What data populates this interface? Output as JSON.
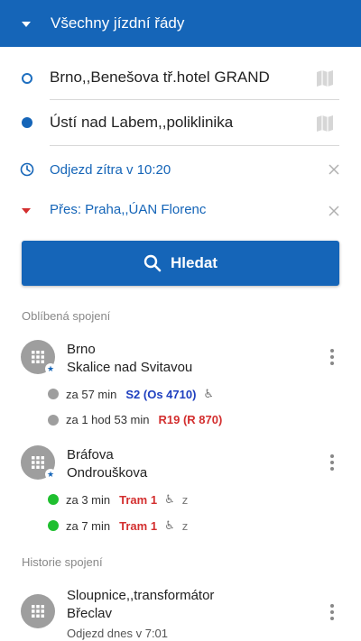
{
  "header": {
    "title": "Všechny jízdní řády"
  },
  "route": {
    "from": "Brno,,Benešova tř.hotel GRAND",
    "to": "Ústí nad Labem,,poliklinika"
  },
  "options": {
    "departure": "Odjezd zítra v 10:20",
    "via": "Přes: Praha,,ÚAN Florenc"
  },
  "search_button": {
    "label": "Hledat"
  },
  "favorites": {
    "header": "Oblíbená spojení",
    "items": [
      {
        "from": "Brno",
        "to": "Skalice nad Svitavou",
        "departures": [
          {
            "time": "za 57 min",
            "line": "S2 (Os 4710)",
            "status_color": "#9e9e9e",
            "line_color": "#1e3fbf",
            "accessible": "♿",
            "z": ""
          },
          {
            "time": "za 1 hod 53 min",
            "line": "R19 (R 870)",
            "status_color": "#9e9e9e",
            "line_color": "#d32f2f",
            "accessible": "",
            "z": ""
          }
        ]
      },
      {
        "from": "Bráfova",
        "to": "Ondrouškova",
        "departures": [
          {
            "time": "za 3 min",
            "line": "Tram 1",
            "status_color": "#1fbf2f",
            "line_color": "#d32f2f",
            "accessible": "♿",
            "z": "z"
          },
          {
            "time": "za 7 min",
            "line": "Tram 1",
            "status_color": "#1fbf2f",
            "line_color": "#d32f2f",
            "accessible": "♿",
            "z": "z"
          }
        ]
      }
    ]
  },
  "history": {
    "header": "Historie spojení",
    "items": [
      {
        "from": "Sloupnice,,transformátor",
        "to": "Břeclav",
        "detail": "Odjezd dnes v 7:01"
      }
    ]
  },
  "colors": {
    "primary": "#1565b8",
    "accent_red": "#d32f2f",
    "status_green": "#1fbf2f",
    "status_gray": "#9e9e9e"
  }
}
